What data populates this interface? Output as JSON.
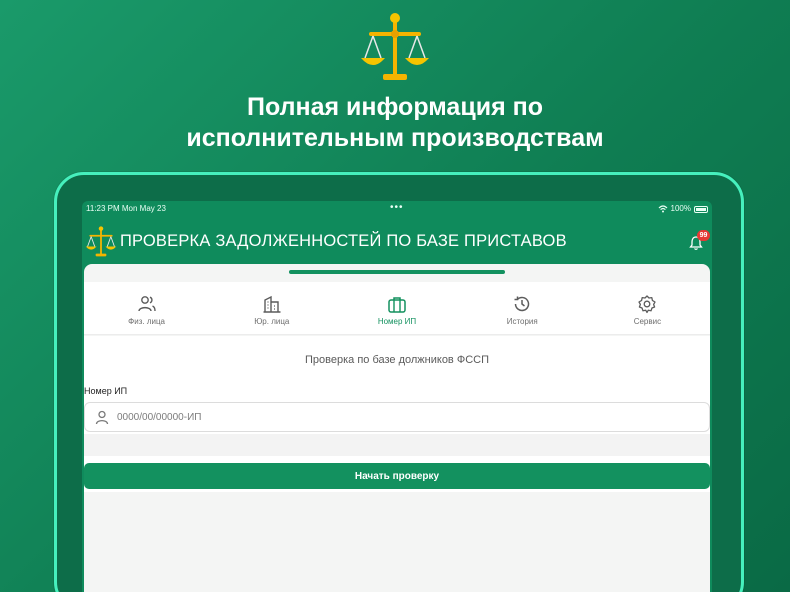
{
  "promo": {
    "title_line1": "Полная информация по",
    "title_line2": "исполнительным производствам",
    "icon": "scales-icon"
  },
  "statusbar": {
    "time": "11:23 PM",
    "date": "Mon May 23",
    "dots": "•••",
    "battery": "100%"
  },
  "appbar": {
    "title": "ПРОВЕРКА ЗАДОЛЖЕННОСТЕЙ ПО БАЗЕ ПРИСТАВОВ",
    "notification_count": "99"
  },
  "tabs": [
    {
      "label": "Физ. лица",
      "icon": "people-icon"
    },
    {
      "label": "Юр. лица",
      "icon": "building-icon"
    },
    {
      "label": "Номер ИП",
      "icon": "briefcase-icon",
      "active": true
    },
    {
      "label": "История",
      "icon": "history-icon"
    },
    {
      "label": "Сервис",
      "icon": "settings-icon"
    }
  ],
  "main": {
    "subtitle": "Проверка по базе должников ФССП",
    "field_label": "Номер ИП",
    "input_placeholder": "0000/00/00000-ИП",
    "input_value": "",
    "start_button": "Начать проверку"
  },
  "colors": {
    "brand": "#13915f",
    "accent_border": "#46f0bd",
    "badge": "#e53935"
  }
}
